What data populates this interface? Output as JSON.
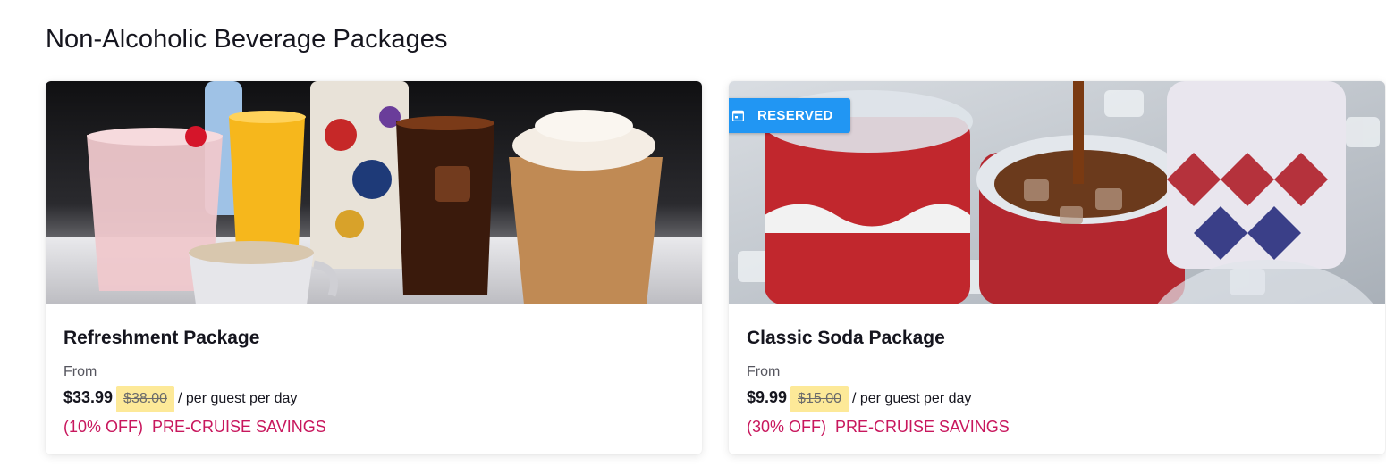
{
  "section": {
    "title": "Non-Alcoholic Beverage Packages"
  },
  "packages": [
    {
      "name": "Refreshment Package",
      "from_label": "From",
      "price": "$33.99",
      "original_price": "$38.00",
      "per_label": "/ per guest per day",
      "discount": "(10% OFF)",
      "savings_label": "PRE-CRUISE SAVINGS",
      "image": "assorted-drinks-photo"
    },
    {
      "name": "Classic Soda Package",
      "from_label": "From",
      "price": "$9.99",
      "original_price": "$15.00",
      "per_label": "/ per guest per day",
      "discount": "(30% OFF)",
      "savings_label": "PRE-CRUISE SAVINGS",
      "image": "soda-cups-on-ice-photo",
      "badge": {
        "label": "RESERVED",
        "icon": "calendar-icon"
      }
    }
  ],
  "colors": {
    "badge": "#2196f3",
    "savings": "#c8175d",
    "highlight": "#fde998"
  }
}
